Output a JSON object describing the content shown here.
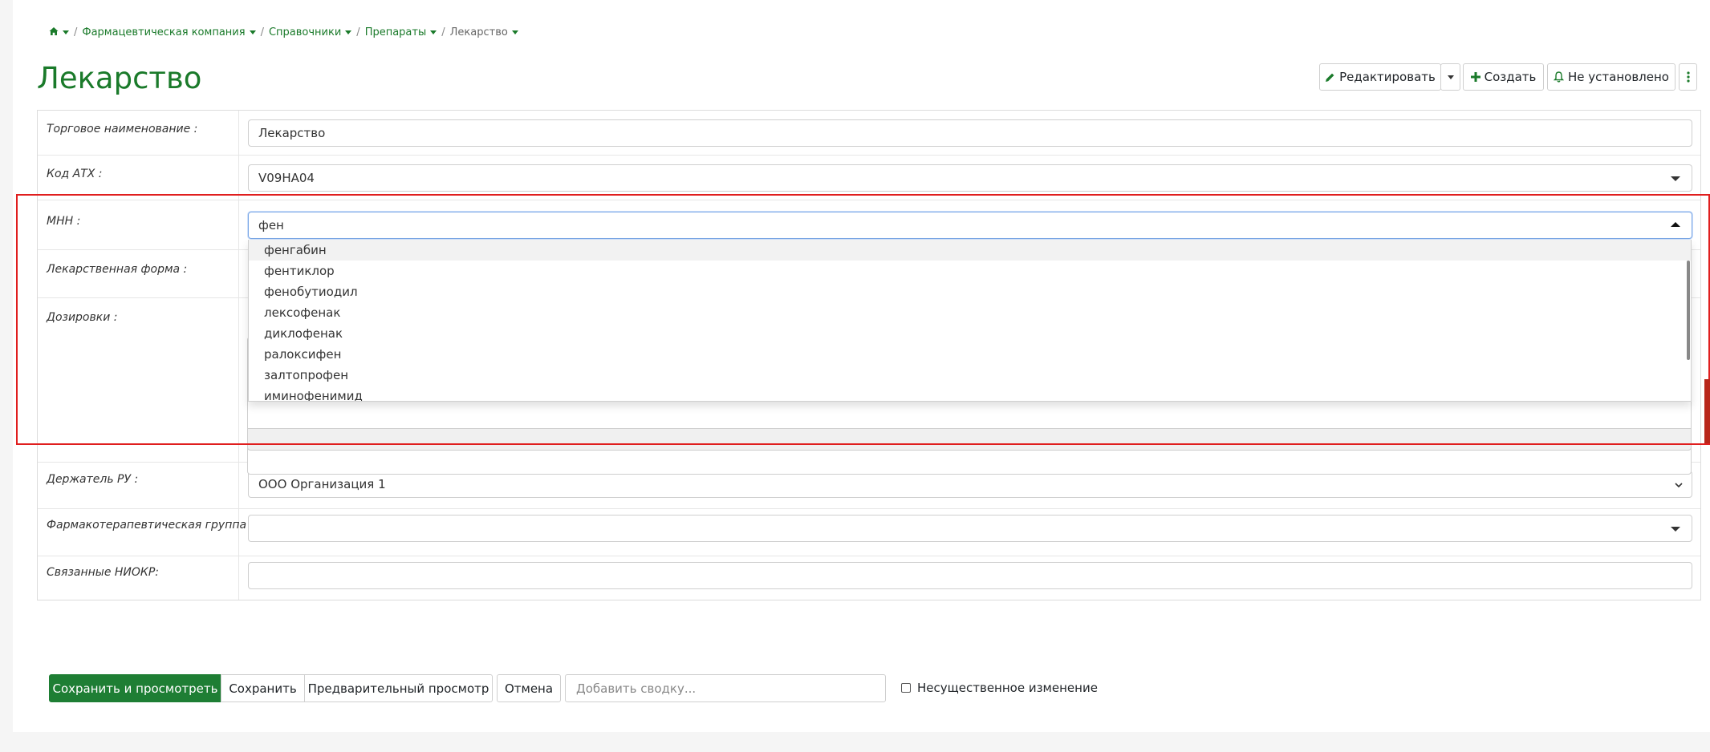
{
  "breadcrumb": {
    "home_icon": "home-icon",
    "items": [
      "Фармацевтическая компания",
      "Справочники",
      "Препараты"
    ],
    "current": "Лекарство"
  },
  "page": {
    "title": "Лекарство"
  },
  "toolbar": {
    "edit_label": "Редактировать",
    "create_label": "Создать",
    "watch_label": "Не установлено"
  },
  "form": {
    "trade_name": {
      "label": "Торговое наименование :",
      "value": "Лекарство"
    },
    "atc_code": {
      "label": "Код АТХ :",
      "value": "V09HA04"
    },
    "inn": {
      "label": "МНН :",
      "value": "фен"
    },
    "dosage_form": {
      "label": "Лекарственная форма :"
    },
    "dosages": {
      "label": "Дозировки :"
    },
    "holder": {
      "label": "Держатель РУ :",
      "value": "ООО Организация 1"
    },
    "pharma_group": {
      "label": "Фармакотерапевтическая группа :",
      "value": ""
    },
    "related_rnd": {
      "label": "Связанные НИОКР:",
      "value": ""
    }
  },
  "inn_dropdown": {
    "options": [
      "фенгабин",
      "фентиклор",
      "фенобутиодил",
      "лексофенак",
      "диклофенак",
      "ралоксифен",
      "залтопрофен",
      "иминофенимид"
    ]
  },
  "actions": {
    "save_view_label": "Сохранить и просмотреть",
    "save_label": "Сохранить",
    "preview_label": "Предварительный просмотр",
    "cancel_label": "Отмена",
    "summary_placeholder": "Добавить сводку...",
    "minor_change_label": "Несущественное изменение"
  },
  "colors": {
    "accent": "#1a7a2a",
    "primary_button": "#1e7e34",
    "highlight": "#e01e1e"
  }
}
